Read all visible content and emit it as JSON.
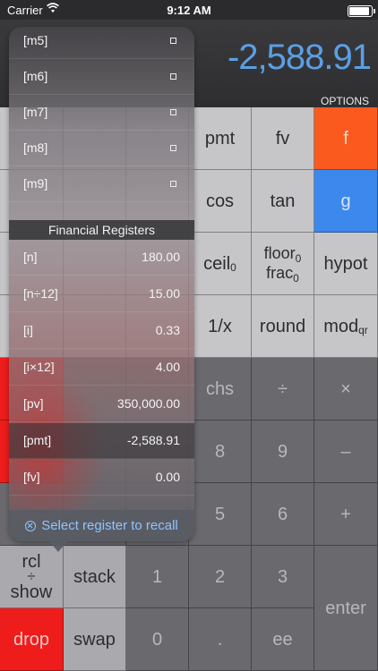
{
  "status": {
    "carrier": "Carrier",
    "time": "9:12 AM"
  },
  "display": {
    "value": "-2,588.91",
    "options_label": "OPTIONS"
  },
  "memory_registers": [
    {
      "label": "[m5]"
    },
    {
      "label": "[m6]"
    },
    {
      "label": "[m7]"
    },
    {
      "label": "[m8]"
    },
    {
      "label": "[m9]"
    }
  ],
  "financial": {
    "header": "Financial Registers",
    "rows": [
      {
        "label": "[n]",
        "value": "180.00"
      },
      {
        "label": "[n÷12]",
        "value": "15.00"
      },
      {
        "label": "[i]",
        "value": "0.33"
      },
      {
        "label": "[i×12]",
        "value": "4.00"
      },
      {
        "label": "[pv]",
        "value": "350,000.00"
      },
      {
        "label": "[pmt]",
        "value": "-2,588.91"
      },
      {
        "label": "[fv]",
        "value": "0.00"
      }
    ]
  },
  "footer": "Select register to recall",
  "keys": {
    "pmt": "pmt",
    "fv": "fv",
    "f": "f",
    "cos": "cos",
    "tan": "tan",
    "g": "g",
    "ceil": "ceil",
    "ceil_sub": "0",
    "floor": "floor",
    "floor_sub": "0",
    "frac": "frac",
    "frac_sub": "0",
    "hypot": "hypot",
    "reciprocal": "1/x",
    "round": "round",
    "mod": "mod",
    "mod_sub": "qr",
    "chs": "chs",
    "divide": "÷",
    "multiply": "×",
    "eight": "8",
    "nine": "9",
    "minus": "–",
    "five": "5",
    "six": "6",
    "plus": "+",
    "rcl": "rcl",
    "rcl_div": "÷",
    "show": "show",
    "stack": "stack",
    "one": "1",
    "two": "2",
    "three": "3",
    "enter": "enter",
    "drop": "drop",
    "swap": "swap",
    "zero": "0",
    "dot": ".",
    "ee": "ee"
  },
  "colors": {
    "accent_orange": "#fb5a1f",
    "accent_blue": "#3c88ec",
    "accent_red": "#ef1c1c",
    "display_blue": "#5b9fe5"
  }
}
